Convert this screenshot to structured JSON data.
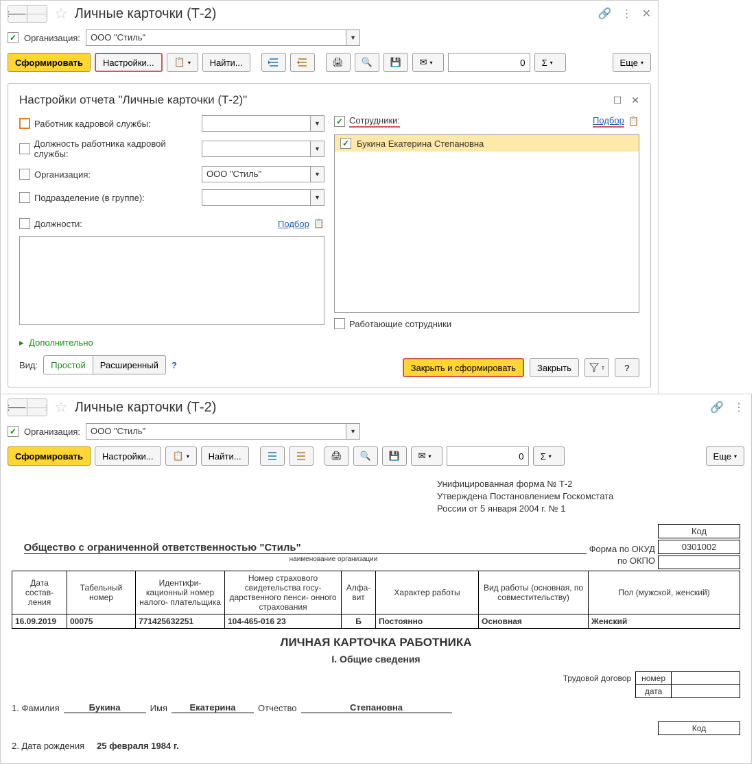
{
  "win1": {
    "title": "Личные карточки (Т-2)",
    "orgLabel": "Организация:",
    "orgValue": "ООО \"Стиль\"",
    "numValue": "0",
    "toolbar": {
      "form": "Сформировать",
      "settings": "Настройки...",
      "find": "Найти...",
      "more": "Еще"
    },
    "dialog": {
      "title": "Настройки отчета \"Личные карточки (Т-2)\"",
      "hrOfficer": "Работник кадровой службы:",
      "hrPosition": "Должность работника кадровой службы:",
      "org": "Организация:",
      "orgValue": "ООО \"Стиль\"",
      "dept": "Подразделение (в группе):",
      "positions": "Должности:",
      "select": "Подбор",
      "employees": "Сотрудники:",
      "emp1": "Букина Екатерина Степановна",
      "working": "Работающие сотрудники",
      "more": "Дополнительно",
      "viewLabel": "Вид:",
      "simple": "Простой",
      "advanced": "Расширенный",
      "closeForm": "Закрыть и сформировать",
      "close": "Закрыть"
    }
  },
  "win2": {
    "title": "Личные карточки (Т-2)",
    "orgLabel": "Организация:",
    "orgValue": "ООО \"Стиль\"",
    "numValue": "0",
    "toolbar": {
      "form": "Сформировать",
      "settings": "Настройки...",
      "find": "Найти...",
      "more": "Еще"
    },
    "doc": {
      "h1": "Унифицированная форма № Т-2",
      "h2": "Утверждена Постановлением Госкомстата",
      "h3": "России от 5 января 2004 г. № 1",
      "kodLabel": "Код",
      "okudLabel": "Форма по ОКУД",
      "okudValue": "0301002",
      "okpoLabel": "по ОКПО",
      "orgFull": "Общество с ограниченной ответственностью \"Стиль\"",
      "orgSub": "наименование организации",
      "th": {
        "date": "Дата состав-\nления",
        "tab": "Табельный номер",
        "inn": "Идентифи-\nкационный номер налого-\nплательщика",
        "snils": "Номер страхового свидетельства госу-\nдарственного пенси-\nонного страхования",
        "alpha": "Алфа-\nвит",
        "char": "Характер работы",
        "type": "Вид работы (основная, по совместительству)",
        "sex": "Пол (мужской, женский)"
      },
      "td": {
        "date": "16.09.2019",
        "tab": "00075",
        "inn": "771425632251",
        "snils": "104-465-016 23",
        "alpha": "Б",
        "char": "Постоянно",
        "type": "Основная",
        "sex": "Женский"
      },
      "title": "ЛИЧНАЯ КАРТОЧКА РАБОТНИКА",
      "section": "I. Общие сведения",
      "contract": "Трудовой договор",
      "contractNum": "номер",
      "contractDate": "дата",
      "famLabel": "1. Фамилия",
      "fam": "Букина",
      "nameLabel": "Имя",
      "name": "Екатерина",
      "patrLabel": "Отчество",
      "patr": "Степановна",
      "kod2": "Код",
      "birthLabel": "2. Дата рождения",
      "birth": "25 февраля 1984 г."
    }
  }
}
